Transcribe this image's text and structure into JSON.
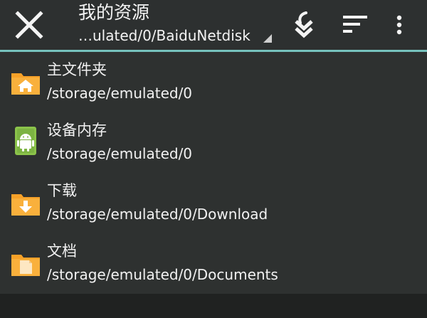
{
  "toolbar": {
    "title": "我的资源",
    "subtitle": "…ulated/0/BaiduNetdisk",
    "close_icon": "close-icon",
    "download_icon": "download-arrows-icon",
    "sort_icon": "sort-icon",
    "more_icon": "more-vertical-icon"
  },
  "colors": {
    "toolbar_bg": "#2d3030",
    "accent": "#76c2bd",
    "list_bg": "#2e3130",
    "folder_orange": "#f7a128",
    "android_green": "#8bc34a"
  },
  "items": [
    {
      "name": "主文件夹",
      "path": "/storage/emulated/0",
      "icon": "home-folder-icon"
    },
    {
      "name": "设备内存",
      "path": "/storage/emulated/0",
      "icon": "android-storage-icon"
    },
    {
      "name": "下载",
      "path": "/storage/emulated/0/Download",
      "icon": "download-folder-icon"
    },
    {
      "name": "文档",
      "path": "/storage/emulated/0/Documents",
      "icon": "documents-folder-icon"
    }
  ]
}
